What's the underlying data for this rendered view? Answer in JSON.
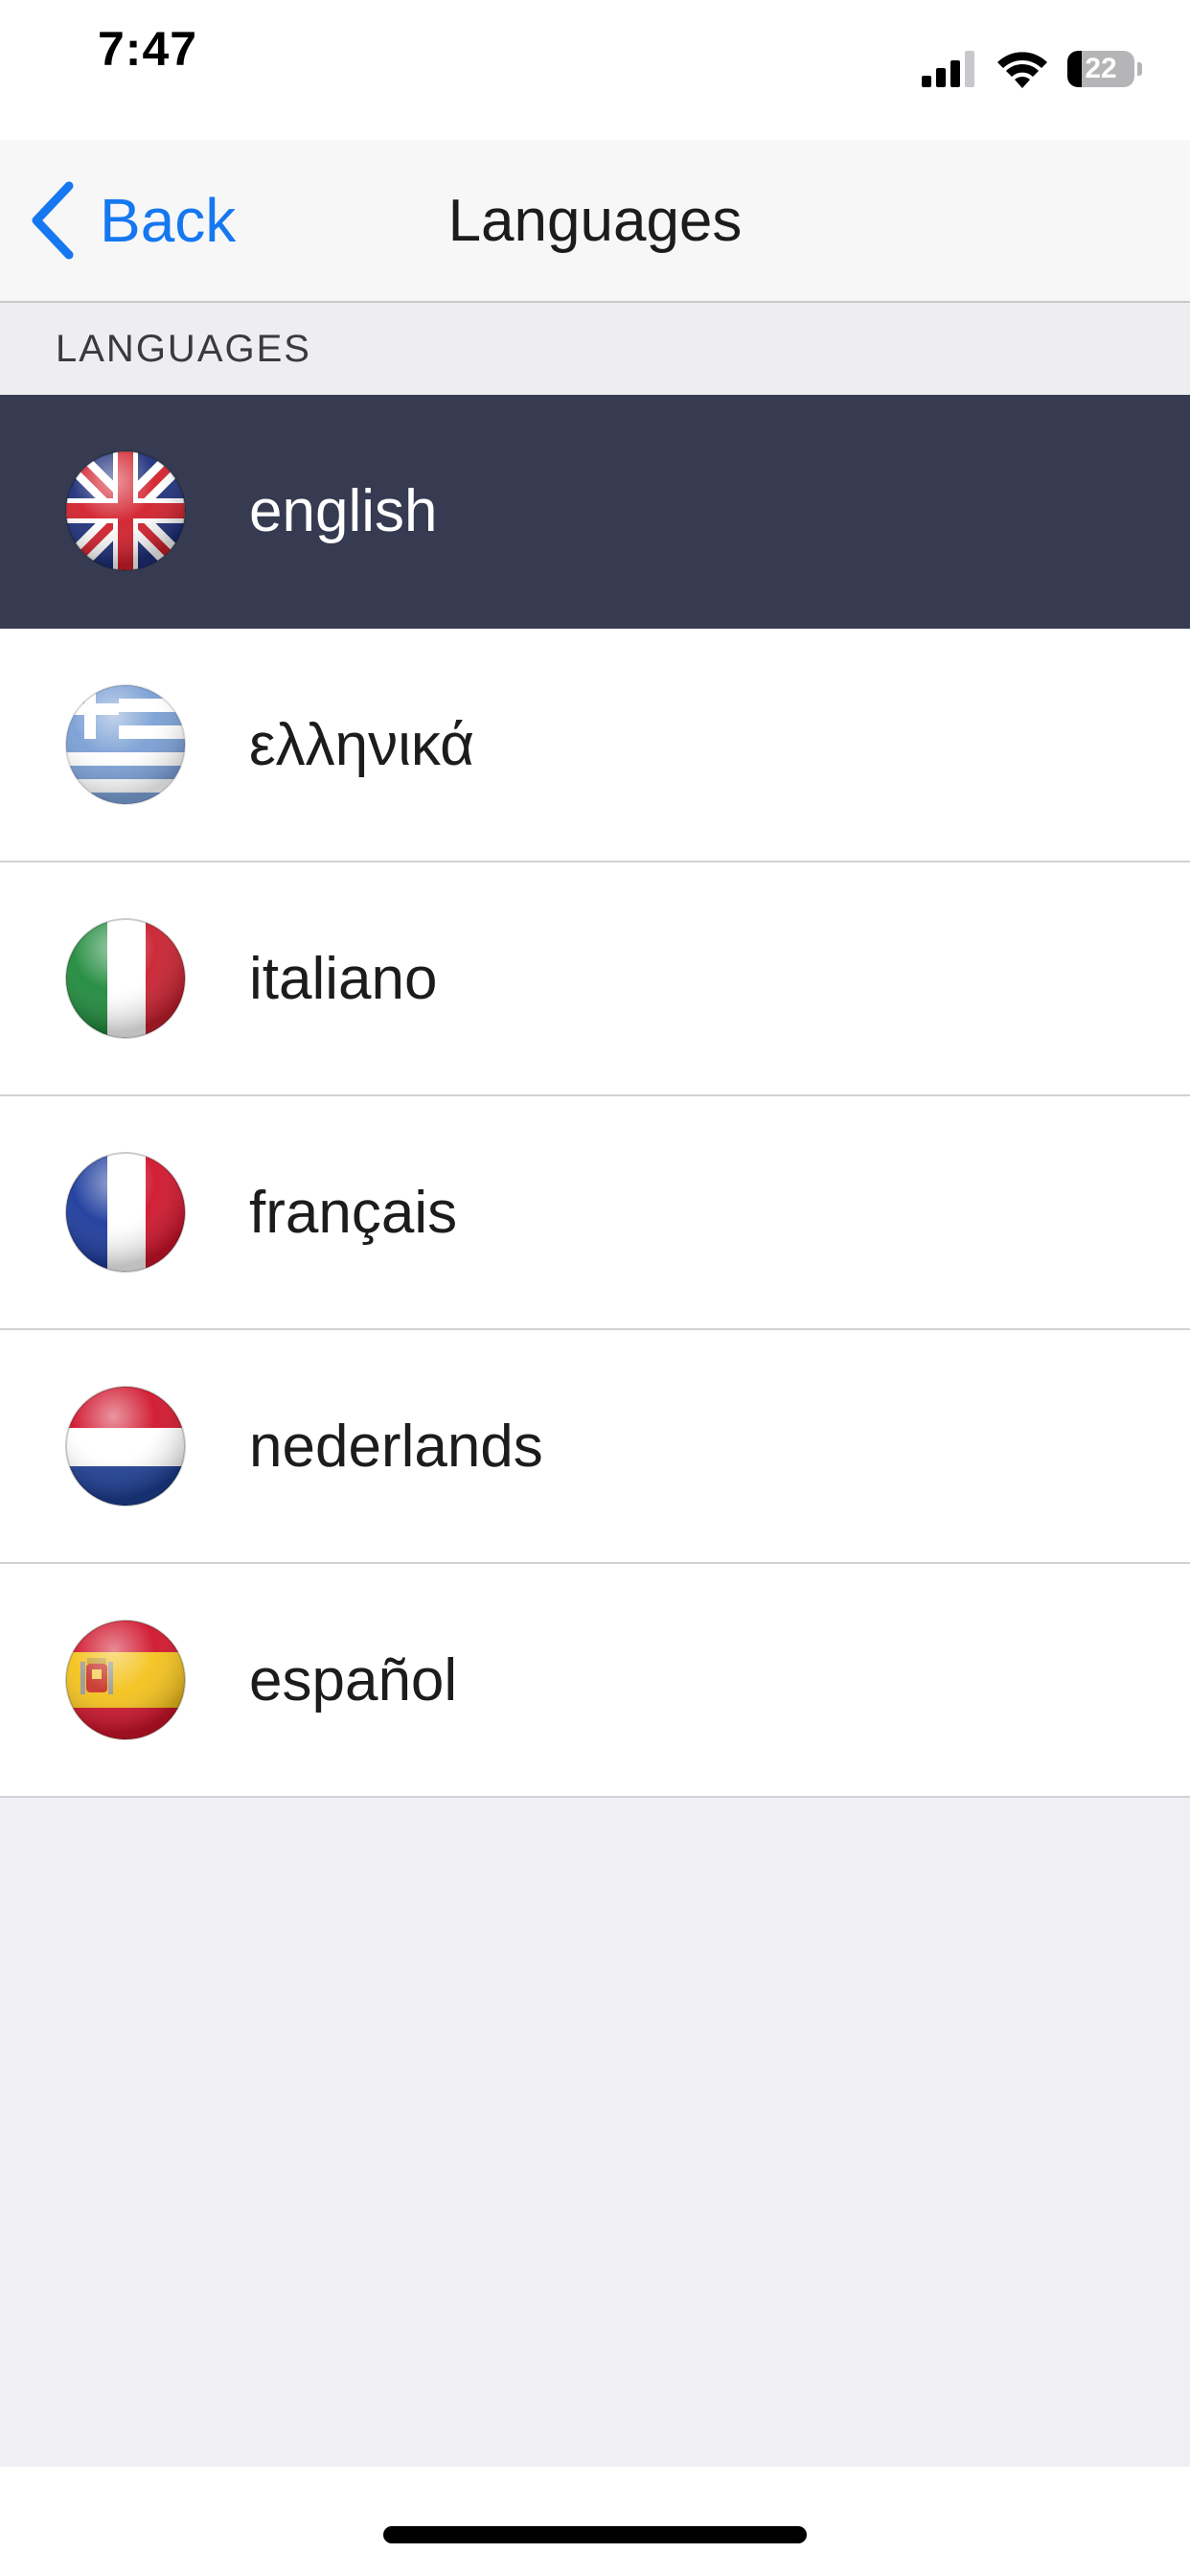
{
  "status_bar": {
    "time": "7:47",
    "battery_percent": "22",
    "battery_level": 0.22,
    "icons": [
      "signal-icon",
      "wifi-icon",
      "battery-icon"
    ]
  },
  "nav": {
    "back_label": "Back",
    "title": "Languages",
    "accent_color": "#1578f0"
  },
  "section": {
    "header": "LANGUAGES"
  },
  "languages": [
    {
      "label": "english",
      "flag": "uk-flag-icon",
      "selected": true
    },
    {
      "label": "ελληνικά",
      "flag": "greece-flag-icon",
      "selected": false
    },
    {
      "label": "italiano",
      "flag": "italy-flag-icon",
      "selected": false
    },
    {
      "label": "français",
      "flag": "france-flag-icon",
      "selected": false
    },
    {
      "label": "nederlands",
      "flag": "netherlands-flag-icon",
      "selected": false
    },
    {
      "label": "español",
      "flag": "spain-flag-icon",
      "selected": false
    }
  ],
  "colors": {
    "selected_row": "#363b52",
    "background": "#efeff4"
  }
}
